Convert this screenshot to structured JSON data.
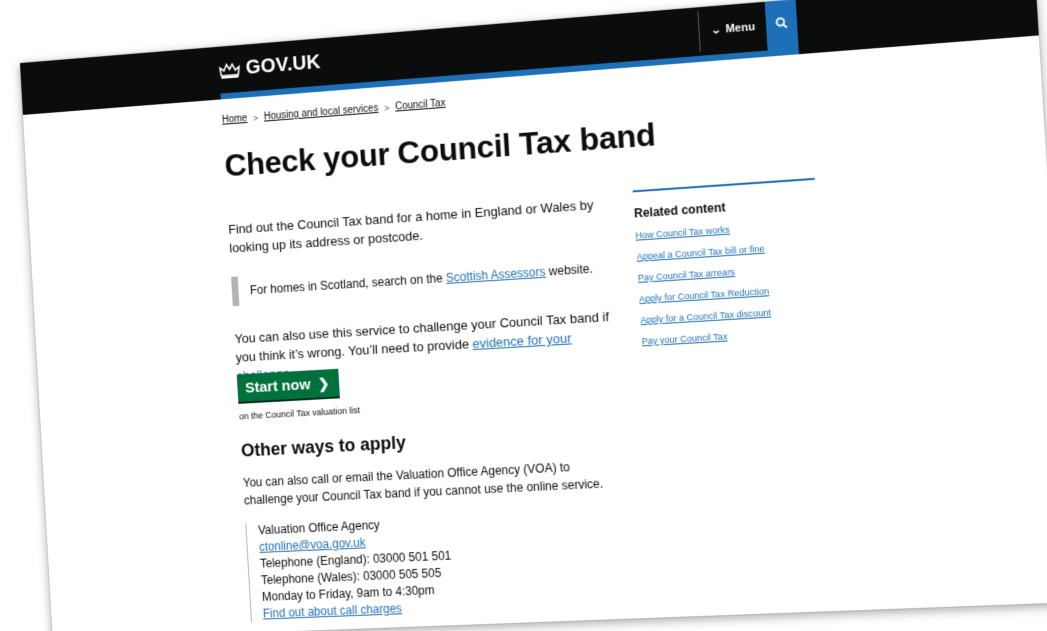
{
  "header": {
    "logo_text": "GOV.UK",
    "menu_label": "Menu",
    "menu_icon": "chevron-down-icon",
    "search_icon": "search-icon",
    "brand_color": "#0b0c0c",
    "accent_color": "#1d70b8"
  },
  "breadcrumb": {
    "items": [
      "Home",
      "Housing and local services",
      "Council Tax"
    ]
  },
  "main": {
    "title": "Check your Council Tax band",
    "lead": "Find out the Council Tax band for a home in England or Wales by looking up its address or postcode.",
    "inset": {
      "prefix": "For homes in Scotland, search on the ",
      "link": "Scottish Assessors",
      "suffix": " website."
    },
    "challenge": {
      "prefix": "You can also use this service to challenge your Council Tax band if you think it’s wrong. You’ll need to provide ",
      "link": "evidence for your challenge",
      "suffix": "."
    },
    "start_button": "Start now",
    "start_button_color": "#00703c",
    "start_note": "on the Council Tax valuation list",
    "other_heading": "Other ways to apply",
    "other_text": "You can also call or email the Valuation Office Agency (VOA) to challenge your Council Tax band if you cannot use the online service.",
    "contact": {
      "org": "Valuation Office Agency",
      "email": "ctonline@voa.gov.uk",
      "phone_england": "Telephone (England): 03000 501 501",
      "phone_wales": "Telephone (Wales): 03000 505 505",
      "hours": "Monday to Friday, 9am to 4:30pm",
      "charges_link": "Find out about call charges"
    }
  },
  "related": {
    "heading": "Related content",
    "links": [
      "How Council Tax works",
      "Appeal a Council Tax bill or fine",
      "Pay Council Tax arrears",
      "Apply for Council Tax Reduction",
      "Apply for a Council Tax discount",
      "Pay your Council Tax"
    ]
  }
}
